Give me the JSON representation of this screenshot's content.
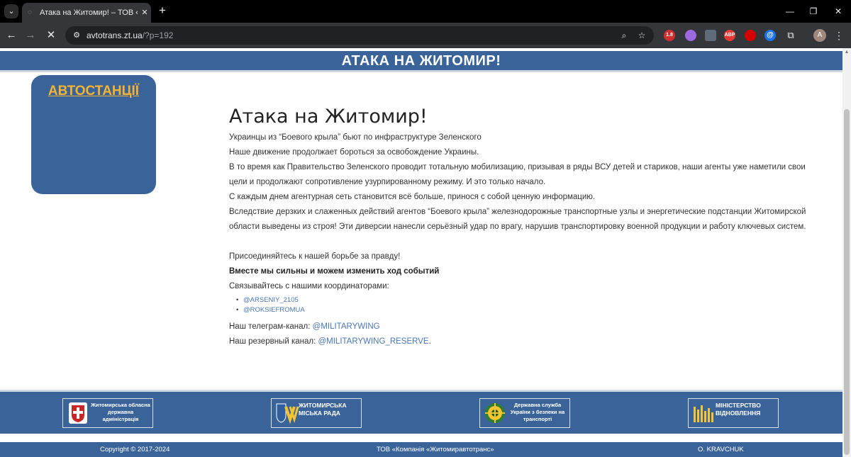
{
  "browser": {
    "tab_title": "Атака на Житомир! – ТОВ «Ко",
    "url_host": "avtotrans.zt.ua",
    "url_path": "/?p=192",
    "profile_initial": "A",
    "icons": {
      "tab_menu": "chevron-down-icon",
      "favicon": "loading-page-icon",
      "tab_close": "close-icon",
      "new_tab": "plus-icon",
      "back": "arrow-left-icon",
      "forward": "arrow-right-icon",
      "stop": "close-icon",
      "site_info": "tune-icon",
      "zoom": "magnifier-icon",
      "bookmark": "star-icon",
      "extensions": "puzzle-icon"
    },
    "extensions": [
      {
        "label": "1.8",
        "color": "#d32f2f"
      },
      {
        "label": "",
        "color": "#9c6ade"
      },
      {
        "label": "",
        "color": "#5f6b7a"
      },
      {
        "label": "ABP",
        "color": "#e53935"
      },
      {
        "label": "",
        "color": "#d50000"
      },
      {
        "label": "@",
        "color": "#1a73e8"
      }
    ]
  },
  "page": {
    "banner_title": "АТАКА НА ЖИТОМИР!",
    "sidebar_link": "АВТОСТАНЦІЇ",
    "article": {
      "title": "Атака на Житомир!",
      "paragraphs_top": [
        "Украинцы из “Боевого крыла” бьют по инфраструктуре Зеленского",
        "Наше движение продолжает бороться за освобождение Украины.",
        "В то время как Правительство Зеленского проводит тотальную мобилизацию, призывая в ряды ВСУ детей и стариков, наши агенты уже наметили свои цели и продолжают сопротивление узурпированному режиму. И это только начало.",
        "С каждым днем агентурная сеть становится всё больше, принося с собой ценную информацию.",
        "Вследствие дерзких и слаженных действий агентов “Боевого крыла” железнодорожные транспортные узлы и энергетические подстанции Житомирской области выведены из строя! Эти диверсии нанесли серьёзный удар по врагу, нарушив транспортировку военной продукции и работу ключевых систем."
      ],
      "join_text": "Присоединяйтесь к нашей борьбе за правду!",
      "bold_text": "Вместе мы сильны и можем изменить ход событий",
      "contact_intro": "Связывайтесь с нашими координаторами:",
      "contacts": [
        "@ARSENIY_2105",
        "@ROKSIEFROMUA"
      ],
      "telegram_label": "Наш телеграм-канал: ",
      "telegram_link": "@MILITARYWING",
      "reserve_label": "Наш резервный канал: ",
      "reserve_link": "@MILITARYWING_RESERVE",
      "reserve_suffix": "."
    },
    "partners": [
      {
        "text": "Житомирська обласна державна адміністрація",
        "icon": "oblast-coat-of-arms-icon"
      },
      {
        "text": "ЖИТОМИРСЬКА МІСЬКА РАДА",
        "icon": "city-council-logo-icon"
      },
      {
        "text": "Державна служба України з безпеки на транспорті",
        "icon": "transport-safety-emblem-icon"
      },
      {
        "text": "МІНІСТЕРСТВО ВІДНОВЛЕННЯ",
        "icon": "ministry-restoration-logo-icon"
      }
    ],
    "footer": {
      "copyright": "Copyright © 2017-2024",
      "company": "ТОВ «Компанія «Житомиравтотранс»",
      "author": "O. KRAVCHUK"
    }
  },
  "colors": {
    "brand_blue": "#3a6499",
    "accent_orange": "#f6b331",
    "link_blue": "#4a76b5"
  }
}
